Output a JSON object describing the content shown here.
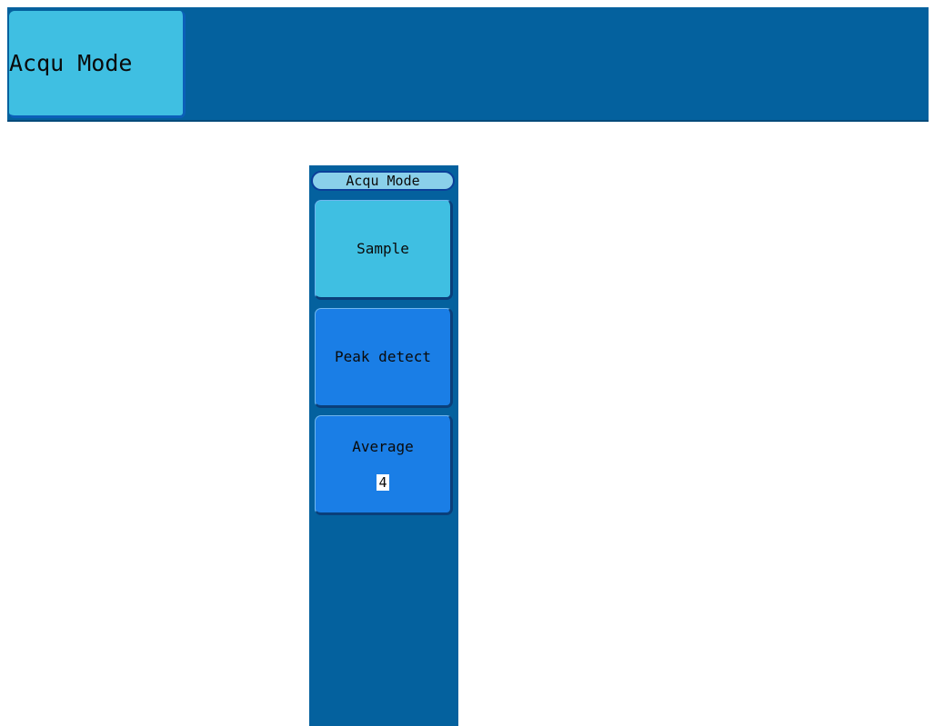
{
  "top_bar": {
    "button_label": "Acqu Mode"
  },
  "menu": {
    "title": "Acqu Mode",
    "options": [
      {
        "label": "Sample",
        "state": "selected"
      },
      {
        "label": "Peak detect",
        "state": "normal"
      },
      {
        "label": "Average",
        "value": "4",
        "state": "normal"
      }
    ]
  },
  "colors": {
    "panel_bg": "#04619e",
    "selected_button": "#3fbfe2",
    "normal_button": "#1a7ee6",
    "title_bg": "#8ad0ea"
  }
}
